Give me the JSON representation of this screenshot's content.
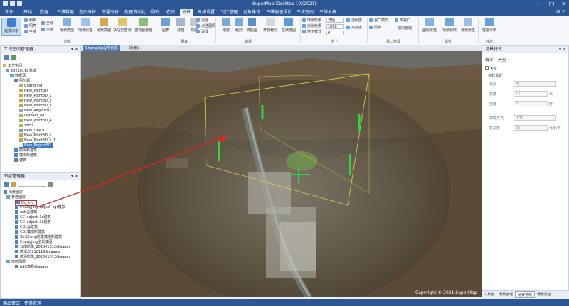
{
  "window": {
    "title": "SuperMap iDesktop 10i(2021)",
    "controls": [
      "—",
      "□",
      "✕"
    ]
  },
  "menu": {
    "items": [
      "文件",
      "开始",
      "数据",
      "三维数据",
      "空间分析",
      "交通分析",
      "处理自动化",
      "视图",
      "在线",
      "场景",
      "风格设置",
      "飞行管理",
      "对象操作",
      "三维地理设计",
      "三维空间",
      "三维分析"
    ],
    "active_index": 9,
    "right_icons": "⚙ ?"
  },
  "ribbon": {
    "big_buttons": [
      "选择对象",
      "场景模型",
      "场景属性",
      "场景截图",
      "多边形查询",
      "查询坐标值",
      "图表",
      "漫游",
      "高度",
      "缩放",
      "裁剪",
      "双视图",
      "开放裁剪",
      "在线地图",
      "剖面线",
      "视口管理",
      "图层属性",
      "场景特效",
      "性能诊断"
    ],
    "small_buttons": [
      "刷新",
      "明亮",
      "平滑",
      "全球",
      "平面",
      "清除",
      "点选图层",
      "设置",
      "环绕效果",
      "对比效果",
      "地下模式",
      "透明度",
      "高亮度",
      "视口模式",
      "单视口",
      "同步"
    ],
    "inputs": [
      "开始",
      "1000",
      "0"
    ],
    "groups": [
      "浏览",
      "量算",
      "数据",
      "地下",
      "视口管理",
      "属性",
      "性能"
    ]
  },
  "workspace_panel": {
    "title": "工作空间管理器",
    "tree": [
      "工作空间",
      "20210118测试",
      "数据源",
      "明创源",
      "Changjing",
      "New_Point3D",
      "New_Point3D_1",
      "New_Point3D_2",
      "New_Point3D_3",
      "New_Region3D",
      "Dataset_88",
      "New_Point3D_4",
      "zzzzz",
      "New_Line3D",
      "New_Point3D_5",
      "New_Point3D_5_1",
      "New_Region3D",
      "模拟新建筑",
      "模拟新建筑",
      "建筑"
    ]
  },
  "layer_panel": {
    "title": "图层管理器",
    "tree": [
      "场景图层",
      "普通图层",
      "Dc_xyz",
      "Changjing_adjust_cgr模拟",
      "xxh@建筑",
      "CC_adjust_3d建筑",
      "CC_adjust_3d建筑",
      "CDz@建筑",
      "CDz模拟新建筑",
      "XinChang影像模拟新建筑",
      "Changjing全景底图",
      "云南影像_202001012@aaaaa",
      "高清20210118@aaaaa",
      "高清影像_202001012@aaaaa",
      "地形图层",
      "ASC高程@aaaaa"
    ]
  },
  "tabs": [
    {
      "label": "Changjing@明创源",
      "active": true
    },
    {
      "label": "场景1",
      "active": false
    }
  ],
  "map": {
    "watermark": "Copyright © 2021 SuperMap"
  },
  "scene_properties": {
    "title": "场景特效",
    "tabs": [
      "海洋",
      "天空"
    ],
    "checkbox_label": "天空",
    "section": "参数设置",
    "rows": [
      {
        "label": "云层",
        "value": "无"
      },
      {
        "label": "高度",
        "value": "15",
        "unit": "米"
      },
      {
        "label": "密度",
        "value": "6",
        "unit": "度"
      },
      {
        "label": "模糊方式",
        "value": "下雪"
      },
      {
        "label": "粒子数",
        "value": "35",
        "unit": "毫米/秒"
      }
    ]
  },
  "bottom_tabs": [
    "工具箱",
    "场景管理",
    "场景特效",
    "场景属性"
  ],
  "status": {
    "left": "输出窗口",
    "center": "任务管理"
  },
  "colors": {
    "titlebar": "#2b5797",
    "accent": "#d8281f",
    "bbox": "#e0d04a",
    "markers": "#2ad64a"
  }
}
